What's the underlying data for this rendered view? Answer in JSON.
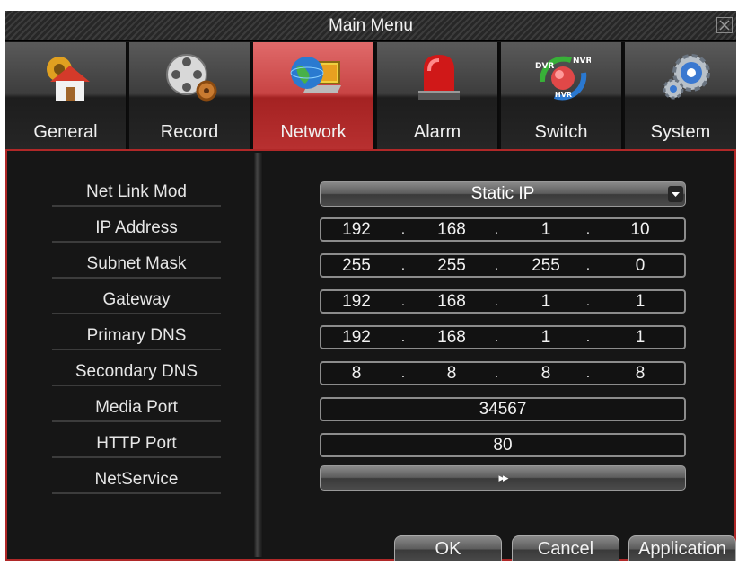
{
  "window": {
    "title": "Main Menu"
  },
  "tabs": [
    {
      "label": "General",
      "icon": "house-gear-icon",
      "active": false
    },
    {
      "label": "Record",
      "icon": "film-reel-icon",
      "active": false
    },
    {
      "label": "Network",
      "icon": "globe-laptop-icon",
      "active": true
    },
    {
      "label": "Alarm",
      "icon": "alarm-siren-icon",
      "active": false
    },
    {
      "label": "Switch",
      "icon": "dvr-nvr-hvr-switch-icon",
      "active": false,
      "icon_text": {
        "dvr": "DVR",
        "nvr": "NVR",
        "hvr": "HVR"
      }
    },
    {
      "label": "System",
      "icon": "gears-icon",
      "active": false
    }
  ],
  "network": {
    "net_link_mode": {
      "label": "Net Link Mod",
      "value": "Static IP"
    },
    "ip_address": {
      "label": "IP Address",
      "octets": [
        "192",
        "168",
        "1",
        "10"
      ]
    },
    "subnet_mask": {
      "label": "Subnet Mask",
      "octets": [
        "255",
        "255",
        "255",
        "0"
      ]
    },
    "gateway": {
      "label": "Gateway",
      "octets": [
        "192",
        "168",
        "1",
        "1"
      ]
    },
    "primary_dns": {
      "label": "Primary DNS",
      "octets": [
        "192",
        "168",
        "1",
        "1"
      ]
    },
    "secondary_dns": {
      "label": "Secondary DNS",
      "octets": [
        "8",
        "8",
        "8",
        "8"
      ]
    },
    "media_port": {
      "label": "Media Port",
      "value": "34567"
    },
    "http_port": {
      "label": "HTTP Port",
      "value": "80"
    },
    "net_service": {
      "label": "NetService",
      "button": "▸▸"
    },
    "separator": "."
  },
  "buttons": {
    "ok": "OK",
    "cancel": "Cancel",
    "apply": "Application"
  },
  "colors": {
    "active_tab": "#c03838",
    "content_border": "#b02828",
    "background": "#161616"
  }
}
